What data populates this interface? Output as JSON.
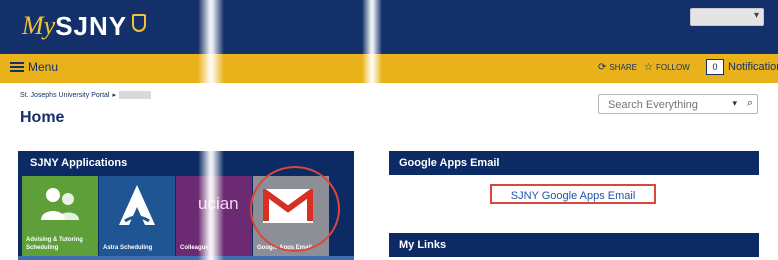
{
  "header": {
    "logo_prefix": "My",
    "logo_text": "SJNY",
    "user_menu_caret": "▾"
  },
  "menu_bar": {
    "menu_label": "Menu",
    "share_label": "SHARE",
    "follow_label": "FOLLOW",
    "notification_count": "0",
    "notifications_label": "Notifications"
  },
  "breadcrumb": {
    "root": "St. Josephs University Portal",
    "separator": "▸"
  },
  "page_title": "Home",
  "search": {
    "placeholder": "Search Everything",
    "caret": "▾",
    "icon": "⌕"
  },
  "apps_panel": {
    "title": "SJNY Applications",
    "tiles": [
      {
        "label": "Advising & Tutoring Scheduling",
        "icon": "people-icon",
        "color": "#5e9f3a"
      },
      {
        "label": "Astra Scheduling",
        "icon": "astra-a-icon",
        "color": "#1f5592"
      },
      {
        "label": "Colleague",
        "icon": "colleague-ellucian-wordmark",
        "wordmark": "ucian",
        "color": "#6b2a71"
      },
      {
        "label": "Google Apps Email",
        "icon": "gmail-icon",
        "color": "#8d8f96"
      }
    ]
  },
  "email_panel": {
    "title": "Google Apps Email",
    "link_text": "SJNY Google Apps Email"
  },
  "my_links": {
    "title": "My Links"
  },
  "colors": {
    "navy": "#14306a",
    "gold": "#eab21a",
    "highlight_red": "#d9473c"
  }
}
